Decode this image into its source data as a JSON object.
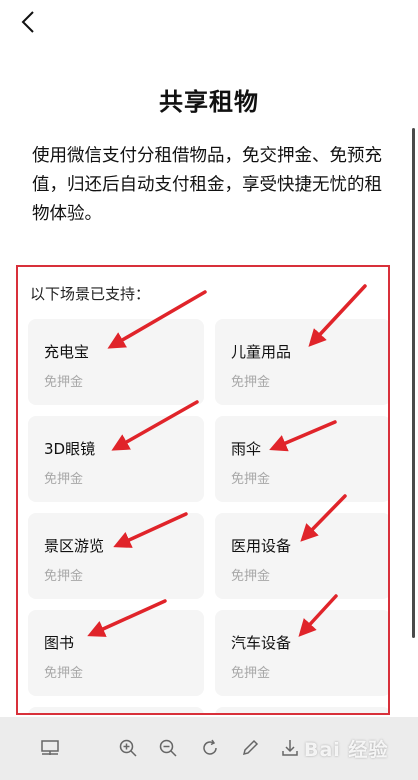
{
  "page": {
    "title": "共享租物",
    "description": "使用微信支付分租借物品，免交押金、免预充值，归还后自动支付租金，享受快捷无忧的租物体验。"
  },
  "scenes": {
    "heading": "以下场景已支持：",
    "items": [
      {
        "name": "充电宝",
        "sub": "免押金"
      },
      {
        "name": "儿童用品",
        "sub": "免押金"
      },
      {
        "name": "3D眼镜",
        "sub": "免押金"
      },
      {
        "name": "雨伞",
        "sub": "免押金"
      },
      {
        "name": "景区游览",
        "sub": "免押金"
      },
      {
        "name": "医用设备",
        "sub": "免押金"
      },
      {
        "name": "图书",
        "sub": "免押金"
      },
      {
        "name": "汽车设备",
        "sub": "免押金"
      }
    ]
  },
  "toolbar": {
    "icons": [
      "layout-icon",
      "zoom-in-icon",
      "zoom-out-icon",
      "rotate-icon",
      "pen-icon",
      "download-icon"
    ]
  },
  "watermark": {
    "text": "Bai 经验"
  },
  "colors": {
    "highlight": "#d8303a",
    "card_bg": "#f5f5f5",
    "sub_text": "#a8a8a8",
    "toolbar_bg": "#ececec"
  }
}
